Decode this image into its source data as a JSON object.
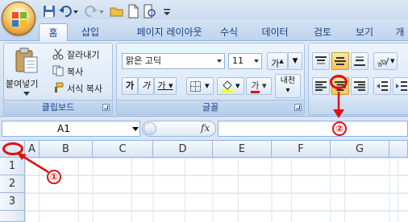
{
  "tabs": [
    "홈",
    "삽입",
    "페이지 레이아웃",
    "수식",
    "데이터",
    "검토",
    "보기",
    "개"
  ],
  "clipboard": {
    "paste_label": "붙여넣기",
    "cut_label": "잘라내기",
    "copy_label": "복사",
    "format_painter_label": "서식 복사",
    "group_label": "클립보드"
  },
  "font": {
    "font_name": "맑은 고딕",
    "font_size": "11",
    "grow_label": "가",
    "bold_label": "가",
    "italic_label": "가",
    "underline_label": "가",
    "font_color_label": "가",
    "phonetic_label": "내천",
    "group_label": "글꼴"
  },
  "formula_bar": {
    "name_box": "A1",
    "fx_label": "fx"
  },
  "sheet": {
    "columns": [
      "A",
      "B",
      "C",
      "D",
      "E",
      "F",
      "G"
    ],
    "rows": [
      "1",
      "2",
      "3"
    ]
  },
  "annotations": {
    "marker_1": "①",
    "marker_2": "②"
  },
  "colors": {
    "annotation": "#e01010",
    "ribbon_text": "#15428b"
  }
}
